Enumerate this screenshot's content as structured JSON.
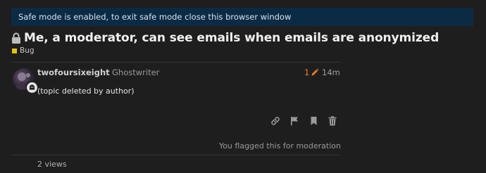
{
  "banner": {
    "text": "Safe mode is enabled, to exit safe mode close this browser window"
  },
  "topic": {
    "title": "Me, a moderator, can see emails when emails are anonymized",
    "category": "Bug",
    "category_color": "#e8c200",
    "lock_icon": "lock-icon"
  },
  "post": {
    "username": "twofoursixeight",
    "user_title": "Ghostwriter",
    "edit_count": "1",
    "age": "14m",
    "body": "(topic deleted by author)",
    "accent_color": "#f07b27"
  },
  "actions": [
    {
      "icon": "link-icon"
    },
    {
      "icon": "flag-icon"
    },
    {
      "icon": "bookmark-icon"
    },
    {
      "icon": "trash-icon"
    }
  ],
  "flag_notice": "You flagged this for moderation",
  "views": "2 views"
}
